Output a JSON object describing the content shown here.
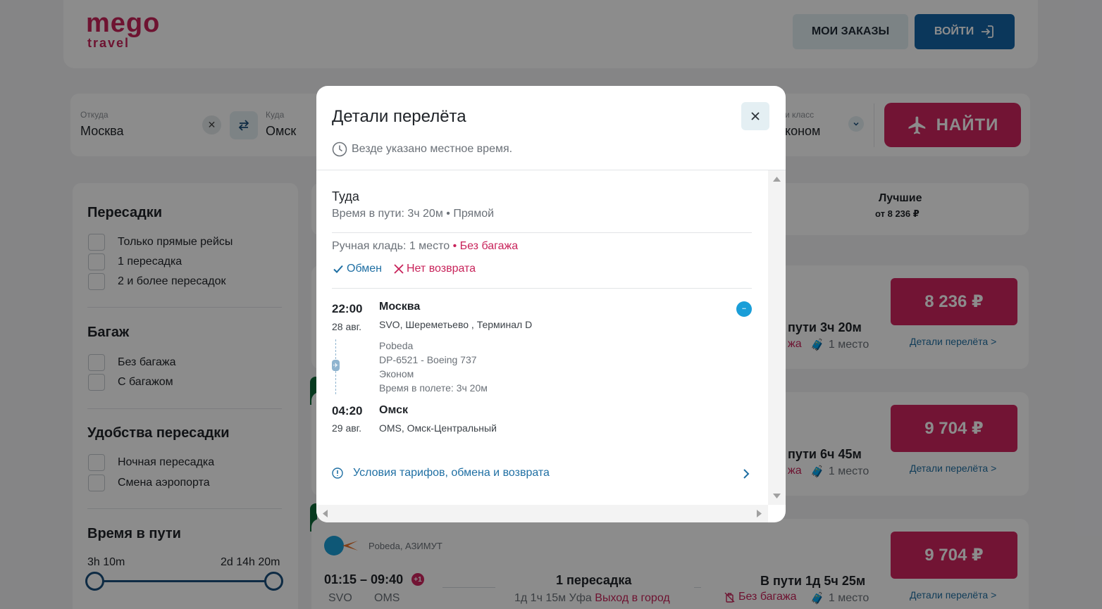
{
  "header": {
    "logo_main": "mego",
    "logo_sub": "travel",
    "orders_label": "МОИ ЗАКАЗЫ",
    "login_label": "ВОЙТИ"
  },
  "search": {
    "from_label": "Откуда",
    "from_value": "Москва",
    "to_label": "Куда",
    "to_value": "Омск",
    "class_label_partial": "и класс",
    "class_value_partial": "коном",
    "find_label": "НАЙТИ"
  },
  "filters": {
    "transfers_title": "Пересадки",
    "transfers": [
      "Только прямые рейсы",
      "1 пересадка",
      "2 и более пересадок"
    ],
    "baggage_title": "Багаж",
    "baggage": [
      "Без багажа",
      "С багажом"
    ],
    "comfort_title": "Удобства пересадки",
    "comfort": [
      "Ночная пересадка",
      "Смена аэропорта"
    ],
    "travel_time_title": "Время в пути",
    "travel_time_min": "3h 10m",
    "travel_time_max": "2d 14h 20m",
    "travel_time_range": [
      0,
      1
    ]
  },
  "sort": {
    "best_title": "Лучшие",
    "best_sub": "от 8 236 ₽"
  },
  "results": [
    {
      "price": "8 236 ₽",
      "details": "Детали перелёта >",
      "duration_partial": "пути 3ч 20м",
      "nobag_partial": "жа",
      "place": "1 место"
    },
    {
      "price": "9 704 ₽",
      "details": "Детали перелёта >",
      "duration_partial": "пути 6ч 45м",
      "nobag_partial": "жа",
      "place": "1 место"
    },
    {
      "price": "9 704 ₽",
      "details": "Детали перелёта >",
      "airline": "Pobeda, АЗИМУТ",
      "time_range": "01:15 – 09:40",
      "plus_day": "+1",
      "from_iata": "SVO",
      "to_iata": "OMS",
      "transfer": "1 пересадка",
      "transfer_time": "1д 1ч 15м Уфа",
      "exit_city": "Выход в город",
      "duration": "В пути 1д 5ч 25м",
      "nobag": "Без багажа",
      "place": "1 место"
    }
  ],
  "modal": {
    "title": "Детали перелёта",
    "note": "Везде указано местное время.",
    "direction": "Туда",
    "direction_sub": "Время в пути: 3ч 20м • Прямой",
    "hand_luggage": "Ручная кладь: 1 место",
    "no_baggage": "• Без багажа",
    "exchange": "Обмен",
    "no_refund": "Нет возврата",
    "departure": {
      "time": "22:00",
      "date": "28 авг.",
      "city": "Москва",
      "airport": "SVO, Шереметьево , Терминал D"
    },
    "flight_info": [
      "Pobeda",
      "DP-6521 - Boeing 737",
      "Эконом",
      "Время в полете: 3ч 20м"
    ],
    "arrival": {
      "time": "04:20",
      "date": "29 авг.",
      "city": "Омск",
      "airport": "OMS, Омск-Центральный"
    },
    "terms_link": "Условия тарифов, обмена и возврата"
  }
}
